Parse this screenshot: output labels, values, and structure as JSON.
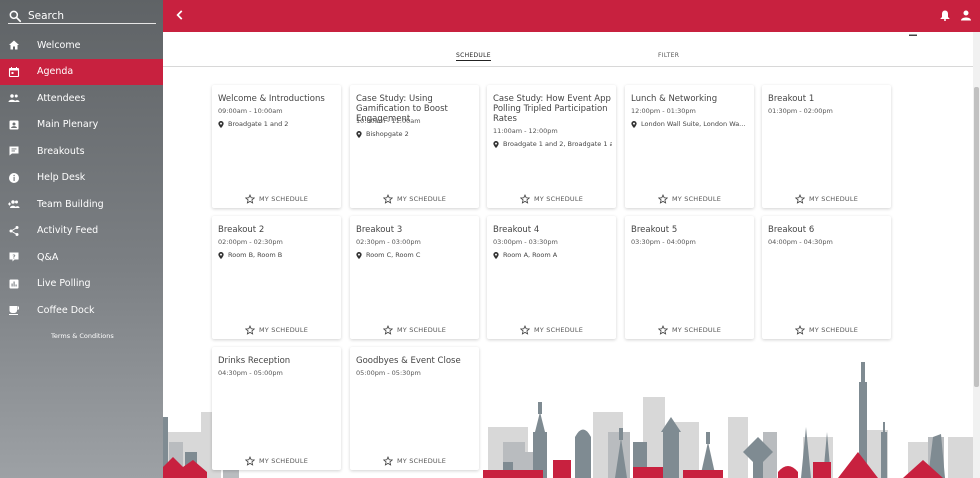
{
  "sidebar": {
    "search_label": "Search",
    "items": [
      {
        "label": "Welcome",
        "icon": "home-icon"
      },
      {
        "label": "Agenda",
        "icon": "calendar-icon",
        "active": true
      },
      {
        "label": "Attendees",
        "icon": "people-icon"
      },
      {
        "label": "Main Plenary",
        "icon": "badge-icon"
      },
      {
        "label": "Breakouts",
        "icon": "chat-icon"
      },
      {
        "label": "Help Desk",
        "icon": "info-icon"
      },
      {
        "label": "Team Building",
        "icon": "group-add-icon"
      },
      {
        "label": "Activity Feed",
        "icon": "share-icon"
      },
      {
        "label": "Q&A",
        "icon": "question-icon"
      },
      {
        "label": "Live Polling",
        "icon": "poll-icon"
      },
      {
        "label": "Coffee Dock",
        "icon": "coffee-icon"
      }
    ],
    "terms": "Terms & Conditions"
  },
  "tabs": {
    "schedule": "SCHEDULE",
    "filter": "FILTER"
  },
  "my_schedule_label": "MY SCHEDULE",
  "sessions": [
    {
      "title": "Welcome & Introductions",
      "time": "09:00am - 10:00am",
      "location": "Broadgate 1 and 2"
    },
    {
      "title": "Case Study: Using Gamification to Boost Engagement",
      "time": "10:00am - 11:00am",
      "location": "Bishopgate 2"
    },
    {
      "title": "Case Study: How Event App Polling Tripled Participation Rates",
      "time": "11:00am - 12:00pm",
      "location": "Broadgate 1 and 2, Broadgate 1 and..."
    },
    {
      "title": "Lunch & Networking",
      "time": "12:00pm - 01:30pm",
      "location": "London Wall Suite, London Wa..."
    },
    {
      "title": "Breakout 1",
      "time": "01:30pm - 02:00pm",
      "location": ""
    },
    {
      "title": "Breakout 2",
      "time": "02:00pm - 02:30pm",
      "location": "Room B, Room B"
    },
    {
      "title": "Breakout 3",
      "time": "02:30pm - 03:00pm",
      "location": "Room C, Room C"
    },
    {
      "title": "Breakout 4",
      "time": "03:00pm - 03:30pm",
      "location": "Room A, Room A"
    },
    {
      "title": "Breakout 5",
      "time": "03:30pm - 04:00pm",
      "location": ""
    },
    {
      "title": "Breakout 6",
      "time": "04:00pm - 04:30pm",
      "location": ""
    },
    {
      "title": "Drinks Reception",
      "time": "04:30pm - 05:00pm",
      "location": ""
    },
    {
      "title": "Goodbyes & Event Close",
      "time": "05:00pm - 05:30pm",
      "location": ""
    }
  ],
  "colors": {
    "accent": "#c8213f",
    "sidebar_top": "#5f6366",
    "sidebar_bottom": "#9da1a5"
  }
}
